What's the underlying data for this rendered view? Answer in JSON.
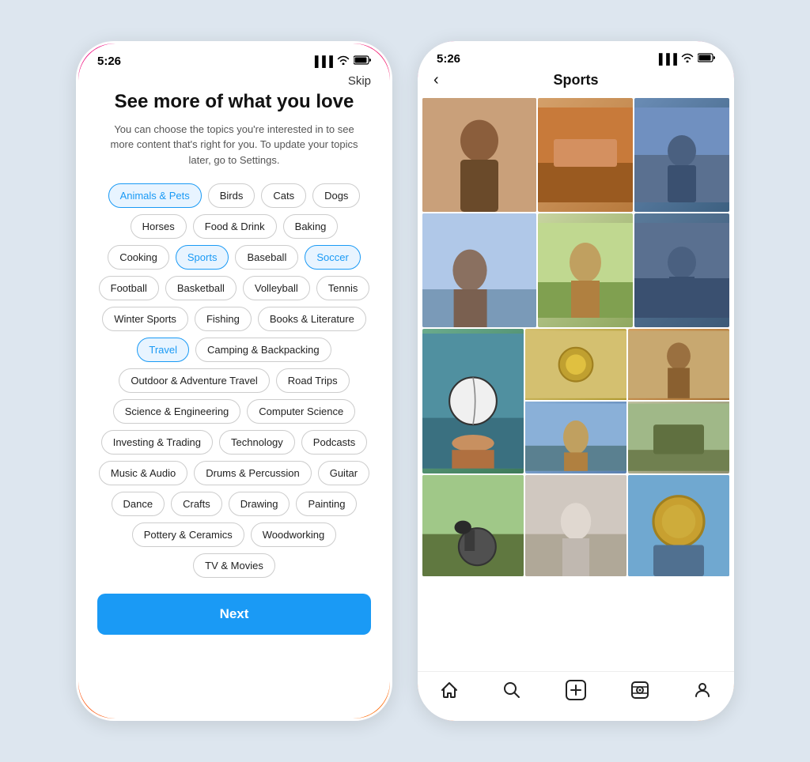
{
  "phone1": {
    "statusBar": {
      "time": "5:26",
      "icons": [
        "signal",
        "wifi",
        "battery"
      ]
    },
    "skipLabel": "Skip",
    "headline": "See more of what you love",
    "subtext": "You can choose the topics you're interested in to see more content that's right for you. To update your topics later, go to Settings.",
    "tags": [
      {
        "label": "Animals & Pets",
        "selected": true
      },
      {
        "label": "Birds",
        "selected": false
      },
      {
        "label": "Cats",
        "selected": false
      },
      {
        "label": "Dogs",
        "selected": false
      },
      {
        "label": "Horses",
        "selected": false
      },
      {
        "label": "Food & Drink",
        "selected": false
      },
      {
        "label": "Baking",
        "selected": false
      },
      {
        "label": "Cooking",
        "selected": false
      },
      {
        "label": "Sports",
        "selected": true
      },
      {
        "label": "Baseball",
        "selected": false
      },
      {
        "label": "Soccer",
        "selected": true
      },
      {
        "label": "Football",
        "selected": false
      },
      {
        "label": "Basketball",
        "selected": false
      },
      {
        "label": "Volleyball",
        "selected": false
      },
      {
        "label": "Tennis",
        "selected": false
      },
      {
        "label": "Winter Sports",
        "selected": false
      },
      {
        "label": "Fishing",
        "selected": false
      },
      {
        "label": "Books & Literature",
        "selected": false
      },
      {
        "label": "Travel",
        "selected": true
      },
      {
        "label": "Camping & Backpacking",
        "selected": false
      },
      {
        "label": "Outdoor & Adventure Travel",
        "selected": false
      },
      {
        "label": "Road Trips",
        "selected": false
      },
      {
        "label": "Science & Engineering",
        "selected": false
      },
      {
        "label": "Computer Science",
        "selected": false
      },
      {
        "label": "Investing & Trading",
        "selected": false
      },
      {
        "label": "Technology",
        "selected": false
      },
      {
        "label": "Podcasts",
        "selected": false
      },
      {
        "label": "Music & Audio",
        "selected": false
      },
      {
        "label": "Drums & Percussion",
        "selected": false
      },
      {
        "label": "Guitar",
        "selected": false
      },
      {
        "label": "Dance",
        "selected": false
      },
      {
        "label": "Crafts",
        "selected": false
      },
      {
        "label": "Drawing",
        "selected": false
      },
      {
        "label": "Painting",
        "selected": false
      },
      {
        "label": "Pottery & Ceramics",
        "selected": false
      },
      {
        "label": "Woodworking",
        "selected": false
      },
      {
        "label": "TV & Movies",
        "selected": false
      }
    ],
    "nextLabel": "Next"
  },
  "phone2": {
    "statusBar": {
      "time": "5:26"
    },
    "backLabel": "‹",
    "title": "Sports",
    "gridItems": 15,
    "nav": {
      "home": "⌂",
      "search": "⌕",
      "add": "+",
      "reels": "▶",
      "profile": "○"
    }
  }
}
